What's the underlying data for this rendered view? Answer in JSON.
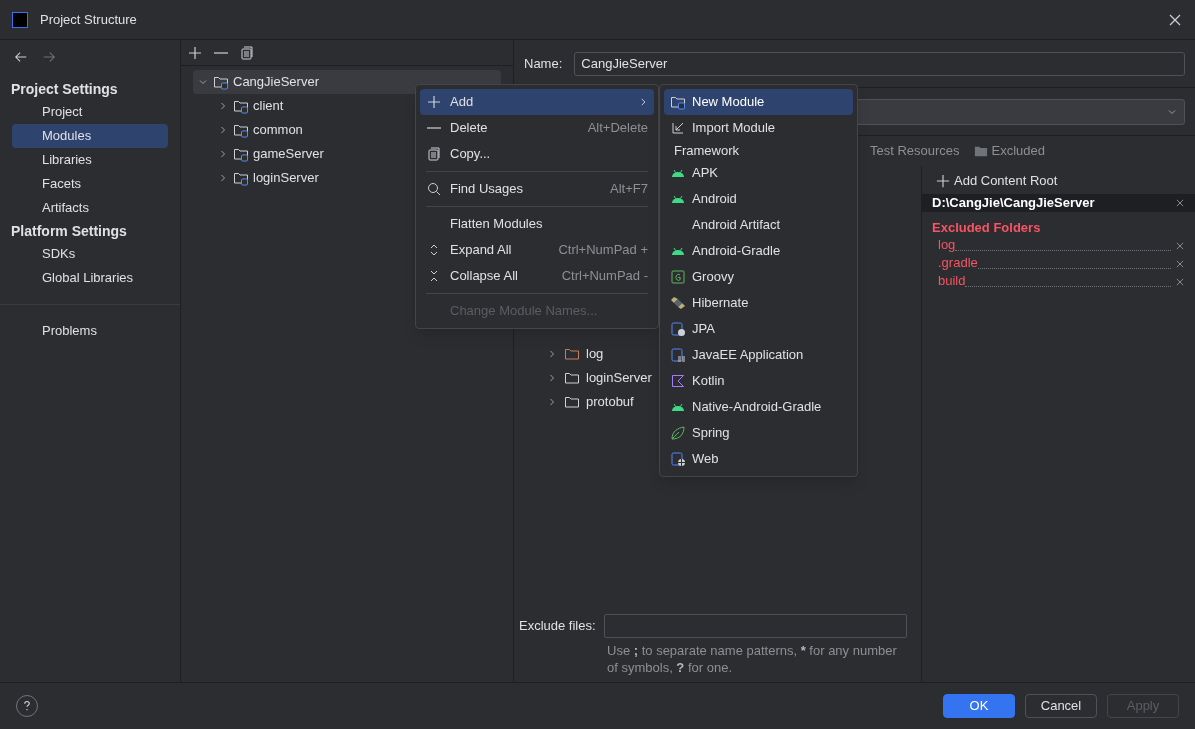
{
  "window": {
    "title": "Project Structure"
  },
  "sidebar": {
    "sections": [
      {
        "title": "Project Settings",
        "items": [
          {
            "label": "Project",
            "selected": false
          },
          {
            "label": "Modules",
            "selected": true
          },
          {
            "label": "Libraries",
            "selected": false
          },
          {
            "label": "Facets",
            "selected": false
          },
          {
            "label": "Artifacts",
            "selected": false
          }
        ]
      },
      {
        "title": "Platform Settings",
        "items": [
          {
            "label": "SDKs",
            "selected": false
          },
          {
            "label": "Global Libraries",
            "selected": false
          }
        ]
      }
    ],
    "bottom_items": [
      {
        "label": "Problems",
        "selected": false
      }
    ]
  },
  "module_tree": [
    {
      "label": "CangJieServer",
      "expanded": true,
      "selected": true,
      "children": [
        {
          "label": "client",
          "expanded": false,
          "selected": false
        },
        {
          "label": "common",
          "expanded": false,
          "selected": false
        },
        {
          "label": "gameServer",
          "expanded": false,
          "selected": false
        },
        {
          "label": "loginServer",
          "expanded": false,
          "selected": false
        }
      ]
    }
  ],
  "name_field": {
    "label": "Name:",
    "value": "CangJieServer"
  },
  "source_tabs": [
    {
      "label": "Test Resources",
      "kind": "test"
    },
    {
      "label": "Excluded",
      "kind": "excluded"
    }
  ],
  "folder_tree": [
    {
      "label": "log",
      "expanded": false,
      "excluded": true
    },
    {
      "label": "loginServer",
      "expanded": false,
      "excluded": false
    },
    {
      "label": "protobuf",
      "expanded": false,
      "excluded": false
    }
  ],
  "content_root": {
    "add_label": "Add Content Root",
    "path": "D:\\CangJie\\CangJieServer",
    "excluded_title": "Excluded Folders",
    "excluded": [
      "log",
      ".gradle",
      "build"
    ]
  },
  "exclude_files": {
    "label": "Exclude files:",
    "hint": [
      {
        "text": "Use ",
        "bold": false
      },
      {
        "text": ";",
        "bold": true
      },
      {
        "text": " to separate name patterns, ",
        "bold": false
      },
      {
        "text": "*",
        "bold": true
      },
      {
        "text": " for any number of symbols, ",
        "bold": false
      },
      {
        "text": "?",
        "bold": true
      },
      {
        "text": " for one.",
        "bold": false
      }
    ]
  },
  "context_menu": {
    "items": [
      {
        "kind": "plus",
        "label": "Add",
        "selected": true,
        "disabled": false,
        "submenu": true
      },
      {
        "kind": "minus",
        "label": "Delete",
        "shortcut": "Alt+Delete",
        "selected": false,
        "disabled": false
      },
      {
        "kind": "copy",
        "label": "Copy...",
        "selected": false,
        "disabled": false,
        "separator_after": true
      },
      {
        "kind": "search",
        "label": "Find Usages",
        "shortcut": "Alt+F7",
        "selected": false,
        "disabled": false,
        "separator_after": true
      },
      {
        "kind": "none",
        "label": "Flatten Modules",
        "selected": false,
        "disabled": false
      },
      {
        "kind": "expand",
        "label": "Expand All",
        "shortcut": "Ctrl+NumPad +",
        "selected": false,
        "disabled": false
      },
      {
        "kind": "collapse",
        "label": "Collapse All",
        "shortcut": "Ctrl+NumPad -",
        "selected": false,
        "disabled": false,
        "separator_after": true
      },
      {
        "kind": "none",
        "label": "Change Module Names...",
        "selected": false,
        "disabled": true
      }
    ]
  },
  "submenu": {
    "items": [
      {
        "kind": "module",
        "label": "New Module",
        "selected": true
      },
      {
        "kind": "import",
        "label": "Import Module",
        "selected": false
      },
      {
        "kind": "header",
        "label": "Framework"
      },
      {
        "kind": "android",
        "label": "APK",
        "selected": false
      },
      {
        "kind": "android",
        "label": "Android",
        "selected": false
      },
      {
        "kind": "none",
        "label": "Android Artifact",
        "selected": false
      },
      {
        "kind": "android",
        "label": "Android-Gradle",
        "selected": false
      },
      {
        "kind": "groovy",
        "label": "Groovy",
        "selected": false
      },
      {
        "kind": "hibernate",
        "label": "Hibernate",
        "selected": false
      },
      {
        "kind": "jpa",
        "label": "JPA",
        "selected": false
      },
      {
        "kind": "javaee",
        "label": "JavaEE Application",
        "selected": false
      },
      {
        "kind": "kotlin",
        "label": "Kotlin",
        "selected": false
      },
      {
        "kind": "android",
        "label": "Native-Android-Gradle",
        "selected": false
      },
      {
        "kind": "spring",
        "label": "Spring",
        "selected": false
      },
      {
        "kind": "web",
        "label": "Web",
        "selected": false
      }
    ]
  },
  "buttons": [
    {
      "label": "OK",
      "kind": "primary",
      "disabled": false
    },
    {
      "label": "Cancel",
      "kind": "normal",
      "disabled": false
    },
    {
      "label": "Apply",
      "kind": "normal",
      "disabled": true
    }
  ]
}
